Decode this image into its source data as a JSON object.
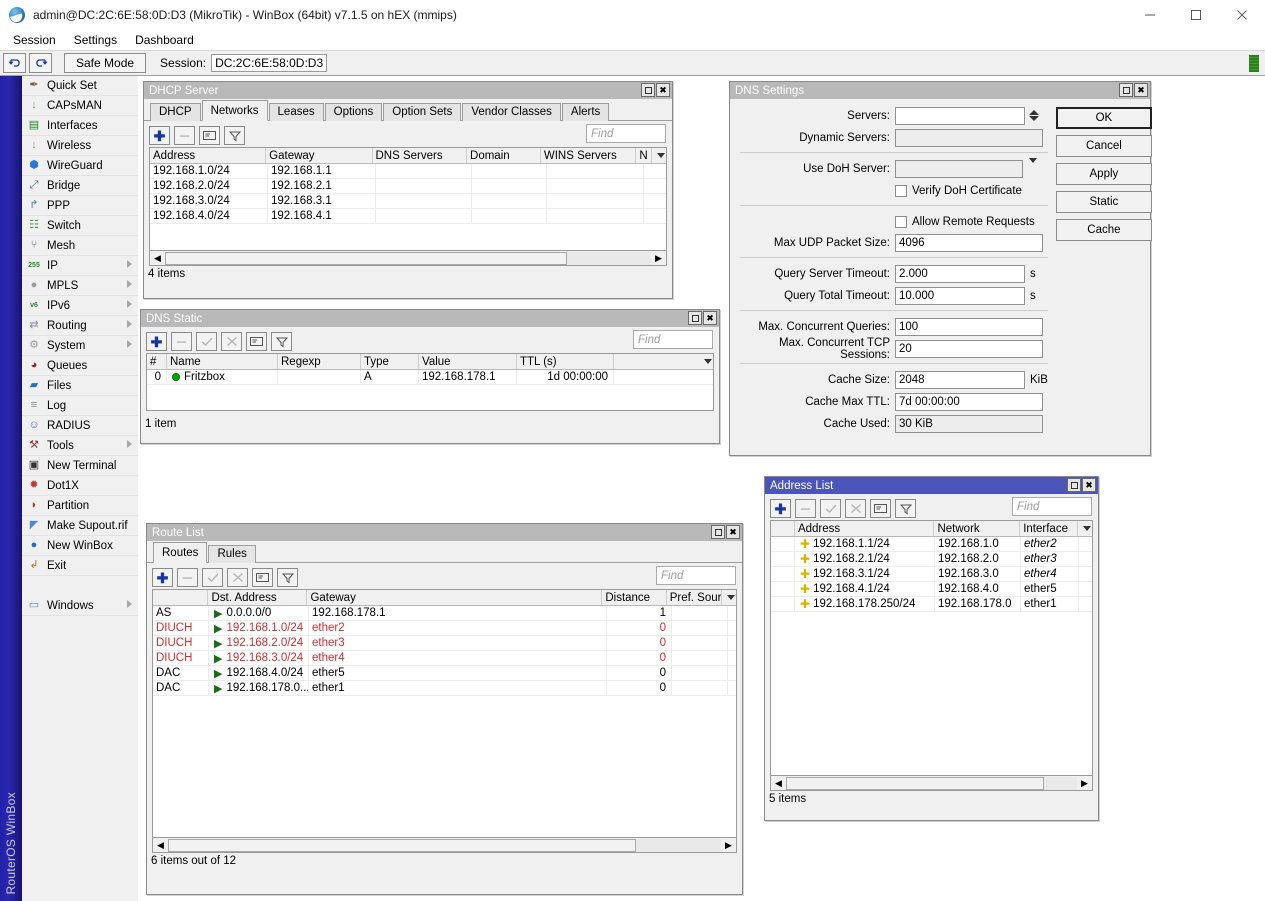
{
  "window": {
    "title": "admin@DC:2C:6E:58:0D:D3 (MikroTik) - WinBox (64bit) v7.1.5 on hEX (mmips)",
    "minimize": "—",
    "maximize": "□",
    "close": "✕"
  },
  "menubar": {
    "items": [
      "Session",
      "Settings",
      "Dashboard"
    ]
  },
  "toolbar": {
    "undo_icon": "undo-icon",
    "redo_icon": "redo-icon",
    "safe_mode": "Safe Mode",
    "session_label": "Session:",
    "session_value": "DC:2C:6E:58:0D:D3",
    "status_color": "#2e7d1e"
  },
  "leftstrip": {
    "label": "RouterOS WinBox",
    "color": "#2320a8"
  },
  "sidebar": {
    "items": [
      {
        "label": "Quick Set",
        "icon": "wand-icon",
        "glyph": "✒",
        "submenu": false
      },
      {
        "label": "CAPsMAN",
        "icon": "antenna-icon",
        "glyph": "↓",
        "submenu": false
      },
      {
        "label": "Interfaces",
        "icon": "interfaces-icon",
        "glyph": "▤",
        "submenu": false
      },
      {
        "label": "Wireless",
        "icon": "wireless-icon",
        "glyph": "↓",
        "submenu": false
      },
      {
        "label": "WireGuard",
        "icon": "wireguard-icon",
        "glyph": "⬢",
        "submenu": false
      },
      {
        "label": "Bridge",
        "icon": "bridge-icon",
        "glyph": "⤢",
        "submenu": false
      },
      {
        "label": "PPP",
        "icon": "ppp-icon",
        "glyph": "↱",
        "submenu": false
      },
      {
        "label": "Switch",
        "icon": "switch-icon",
        "glyph": "☷",
        "submenu": false
      },
      {
        "label": "Mesh",
        "icon": "mesh-icon",
        "glyph": "⑂",
        "submenu": false
      },
      {
        "label": "IP",
        "icon": "ip-icon",
        "glyph": "255",
        "submenu": true
      },
      {
        "label": "MPLS",
        "icon": "mpls-icon",
        "glyph": "●",
        "submenu": true
      },
      {
        "label": "IPv6",
        "icon": "ipv6-icon",
        "glyph": "v6",
        "submenu": true
      },
      {
        "label": "Routing",
        "icon": "routing-icon",
        "glyph": "⇄",
        "submenu": true
      },
      {
        "label": "System",
        "icon": "system-icon",
        "glyph": "⚙",
        "submenu": true
      },
      {
        "label": "Queues",
        "icon": "queues-icon",
        "glyph": "◕",
        "submenu": false
      },
      {
        "label": "Files",
        "icon": "folder-icon",
        "glyph": "▰",
        "submenu": false
      },
      {
        "label": "Log",
        "icon": "log-icon",
        "glyph": "≡",
        "submenu": false
      },
      {
        "label": "RADIUS",
        "icon": "radius-icon",
        "glyph": "☺",
        "submenu": false
      },
      {
        "label": "Tools",
        "icon": "tools-icon",
        "glyph": "⚒",
        "submenu": true
      },
      {
        "label": "New Terminal",
        "icon": "terminal-icon",
        "glyph": "▣",
        "submenu": false
      },
      {
        "label": "Dot1X",
        "icon": "dot1x-icon",
        "glyph": "✹",
        "submenu": false
      },
      {
        "label": "Partition",
        "icon": "partition-icon",
        "glyph": "◗",
        "submenu": false
      },
      {
        "label": "Make Supout.rif",
        "icon": "document-icon",
        "glyph": "◤",
        "submenu": false
      },
      {
        "label": "New WinBox",
        "icon": "winbox-icon",
        "glyph": "●",
        "submenu": false
      },
      {
        "label": "Exit",
        "icon": "exit-icon",
        "glyph": "↲",
        "submenu": false
      }
    ],
    "windows_item": {
      "label": "Windows",
      "icon": "windows-icon",
      "glyph": "▭",
      "submenu": true
    }
  },
  "dhcp_server": {
    "title": "DHCP Server",
    "tabs": [
      "DHCP",
      "Networks",
      "Leases",
      "Options",
      "Option Sets",
      "Vendor Classes",
      "Alerts"
    ],
    "selected_tab": "Networks",
    "toolbar": [
      "add-icon",
      "remove-icon",
      "comment-icon",
      "filter-icon"
    ],
    "find_placeholder": "Find",
    "columns": [
      "Address",
      "Gateway",
      "DNS Servers",
      "Domain",
      "WINS Servers",
      "N"
    ],
    "rows": [
      {
        "address": "192.168.1.0/24",
        "gateway": "192.168.1.1",
        "dns": "",
        "domain": "",
        "wins": ""
      },
      {
        "address": "192.168.2.0/24",
        "gateway": "192.168.2.1",
        "dns": "",
        "domain": "",
        "wins": ""
      },
      {
        "address": "192.168.3.0/24",
        "gateway": "192.168.3.1",
        "dns": "",
        "domain": "",
        "wins": ""
      },
      {
        "address": "192.168.4.0/24",
        "gateway": "192.168.4.1",
        "dns": "",
        "domain": "",
        "wins": ""
      }
    ],
    "status": "4 items"
  },
  "dns_static": {
    "title": "DNS Static",
    "toolbar": [
      "add-icon",
      "remove-icon",
      "enable-icon",
      "disable-icon",
      "comment-icon",
      "filter-icon"
    ],
    "find_placeholder": "Find",
    "columns": [
      "#",
      "Name",
      "Regexp",
      "Type",
      "Value",
      "TTL (s)"
    ],
    "rows": [
      {
        "num": "0",
        "name": "Fritzbox",
        "regexp": "",
        "type": "A",
        "value": "192.168.178.1",
        "ttl": "1d 00:00:00"
      }
    ],
    "status": "1 item"
  },
  "dns_settings": {
    "title": "DNS Settings",
    "fields": [
      {
        "label": "Servers:",
        "value": "",
        "unit": "",
        "type": "spinner",
        "readonly": false
      },
      {
        "label": "Dynamic Servers:",
        "value": "",
        "unit": "",
        "type": "text",
        "readonly": true
      },
      {
        "label": "Use DoH Server:",
        "value": "",
        "unit": "",
        "type": "combo",
        "readonly": false
      },
      {
        "label": "Max UDP Packet Size:",
        "value": "4096",
        "unit": "",
        "type": "text",
        "readonly": false
      },
      {
        "label": "Query Server Timeout:",
        "value": "2.000",
        "unit": "s",
        "type": "text",
        "readonly": false
      },
      {
        "label": "Query Total Timeout:",
        "value": "10.000",
        "unit": "s",
        "type": "text",
        "readonly": false
      },
      {
        "label": "Max. Concurrent Queries:",
        "value": "100",
        "unit": "",
        "type": "text",
        "readonly": false
      },
      {
        "label": "Max. Concurrent TCP Sessions:",
        "value": "20",
        "unit": "",
        "type": "text",
        "readonly": false
      },
      {
        "label": "Cache Size:",
        "value": "2048",
        "unit": "KiB",
        "type": "text",
        "readonly": false
      },
      {
        "label": "Cache Max TTL:",
        "value": "7d 00:00:00",
        "unit": "",
        "type": "text",
        "readonly": false
      },
      {
        "label": "Cache Used:",
        "value": "30 KiB",
        "unit": "",
        "type": "text",
        "readonly": true
      }
    ],
    "checkboxes": [
      {
        "label": "Verify DoH Certificate",
        "checked": false
      },
      {
        "label": "Allow Remote Requests",
        "checked": false
      }
    ],
    "buttons": [
      "OK",
      "Cancel",
      "Apply",
      "Static",
      "Cache"
    ],
    "default_button": "OK"
  },
  "route_list": {
    "title": "Route List",
    "tabs": [
      "Routes",
      "Rules"
    ],
    "selected_tab": "Routes",
    "toolbar": [
      "add-icon",
      "remove-icon",
      "enable-icon",
      "disable-icon",
      "comment-icon",
      "filter-icon"
    ],
    "find_placeholder": "Find",
    "columns": [
      "",
      "Dst. Address",
      "Gateway",
      "Distance",
      "Pref. Source"
    ],
    "rows": [
      {
        "flags": "AS",
        "dst": "0.0.0.0/0",
        "gateway": "192.168.178.1",
        "distance": "1",
        "pref": "",
        "color": "#000000"
      },
      {
        "flags": "DIUCH",
        "dst": "192.168.1.0/24",
        "gateway": "ether2",
        "distance": "0",
        "pref": "",
        "color": "#d03030"
      },
      {
        "flags": "DIUCH",
        "dst": "192.168.2.0/24",
        "gateway": "ether3",
        "distance": "0",
        "pref": "",
        "color": "#d03030"
      },
      {
        "flags": "DIUCH",
        "dst": "192.168.3.0/24",
        "gateway": "ether4",
        "distance": "0",
        "pref": "",
        "color": "#d03030"
      },
      {
        "flags": "DAC",
        "dst": "192.168.4.0/24",
        "gateway": "ether5",
        "distance": "0",
        "pref": "",
        "color": "#000000"
      },
      {
        "flags": "DAC",
        "dst": "192.168.178.0...",
        "gateway": "ether1",
        "distance": "0",
        "pref": "",
        "color": "#000000"
      }
    ],
    "status": "6 items out of 12"
  },
  "address_list": {
    "title": "Address List",
    "toolbar": [
      "add-icon",
      "remove-icon",
      "enable-icon",
      "disable-icon",
      "comment-icon",
      "filter-icon"
    ],
    "find_placeholder": "Find",
    "columns": [
      "",
      "Address",
      "Network",
      "Interface"
    ],
    "rows": [
      {
        "address": "192.168.1.1/24",
        "network": "192.168.1.0",
        "interface": "ether2",
        "italic": true
      },
      {
        "address": "192.168.2.1/24",
        "network": "192.168.2.0",
        "interface": "ether3",
        "italic": true
      },
      {
        "address": "192.168.3.1/24",
        "network": "192.168.3.0",
        "interface": "ether4",
        "italic": true
      },
      {
        "address": "192.168.4.1/24",
        "network": "192.168.4.0",
        "interface": "ether5",
        "italic": false
      },
      {
        "address": "192.168.178.250/24",
        "network": "192.168.178.0",
        "interface": "ether1",
        "italic": false
      }
    ],
    "status": "5 items"
  }
}
